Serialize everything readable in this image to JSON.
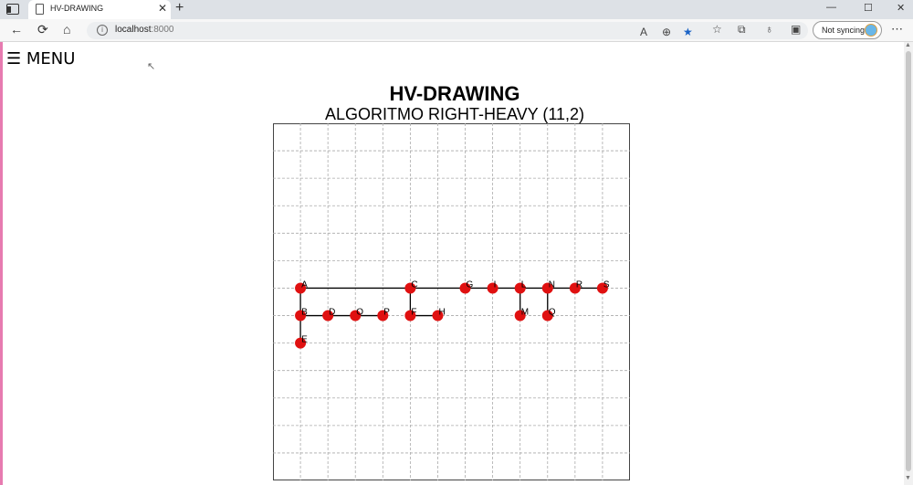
{
  "browser": {
    "tab_title": "HV-DRAWING",
    "tab_close": "✕",
    "new_tab": "+",
    "url_host": "localhost",
    "url_port": ":8000",
    "sync_label": "Not syncing",
    "controls": {
      "minimize": "—",
      "maximize": "☐",
      "close": "✕"
    }
  },
  "page": {
    "menu_label": "☰ MENU",
    "title": "HV-DRAWING",
    "subtitle": "ALGORITMO RIGHT-HEAVY (11,2)"
  },
  "drawing": {
    "grid": {
      "cols": 13,
      "rows": 13
    },
    "nodes": [
      {
        "label": "A",
        "col": 1,
        "row": 6
      },
      {
        "label": "B",
        "col": 1,
        "row": 7
      },
      {
        "label": "C",
        "col": 5,
        "row": 6
      },
      {
        "label": "D",
        "col": 2,
        "row": 7
      },
      {
        "label": "E",
        "col": 1,
        "row": 8
      },
      {
        "label": "F",
        "col": 5,
        "row": 7
      },
      {
        "label": "G",
        "col": 7,
        "row": 6
      },
      {
        "label": "H",
        "col": 6,
        "row": 7
      },
      {
        "label": "I",
        "col": 8,
        "row": 6
      },
      {
        "label": "L",
        "col": 9,
        "row": 6
      },
      {
        "label": "M",
        "col": 9,
        "row": 7
      },
      {
        "label": "N",
        "col": 10,
        "row": 6
      },
      {
        "label": "O",
        "col": 3,
        "row": 7
      },
      {
        "label": "P",
        "col": 4,
        "row": 7
      },
      {
        "label": "Q",
        "col": 10,
        "row": 7
      },
      {
        "label": "R",
        "col": 11,
        "row": 6
      },
      {
        "label": "S",
        "col": 12,
        "row": 6
      }
    ],
    "edges": [
      [
        "A",
        "B"
      ],
      [
        "B",
        "E"
      ],
      [
        "B",
        "D"
      ],
      [
        "D",
        "O"
      ],
      [
        "O",
        "P"
      ],
      [
        "A",
        "C"
      ],
      [
        "C",
        "F"
      ],
      [
        "F",
        "H"
      ],
      [
        "C",
        "G"
      ],
      [
        "G",
        "I"
      ],
      [
        "I",
        "L"
      ],
      [
        "L",
        "M"
      ],
      [
        "L",
        "N"
      ],
      [
        "N",
        "Q"
      ],
      [
        "N",
        "R"
      ],
      [
        "R",
        "S"
      ]
    ],
    "colors": {
      "node": "#e01010",
      "edge": "#000000",
      "grid": "#aaaaaa"
    }
  }
}
